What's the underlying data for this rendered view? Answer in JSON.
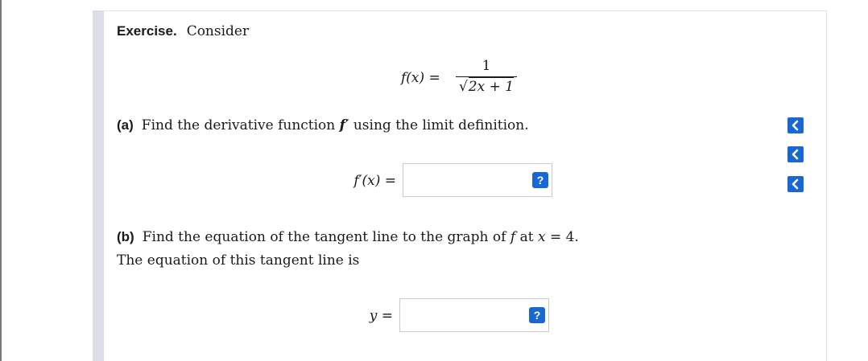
{
  "exercise": {
    "label": "Exercise.",
    "intro": "Consider"
  },
  "formula": {
    "lhs": "f(x) =",
    "numerator": "1",
    "radicand": "2x + 1",
    "sqrt_symbol": "√"
  },
  "part_a": {
    "label": "(a)",
    "text_before": "Find the derivative function",
    "symbol": "f′",
    "text_after": "using the limit definition."
  },
  "answer_a": {
    "label": "f′(x) =",
    "value": "",
    "help_label": "?"
  },
  "part_b": {
    "label": "(b)",
    "text_before": "Find the equation of the tangent line to the graph of",
    "symbol_f": "f",
    "text_at": "at",
    "symbol_x": "x",
    "equals": "= 4."
  },
  "part_b_followup": {
    "text": "The equation of this tangent line is"
  },
  "answer_b": {
    "label": "y =",
    "value": "",
    "help_label": "?"
  },
  "side_nav": {
    "icon": "chevron-left-icon",
    "count": 3
  },
  "colors": {
    "accent": "#1967d2",
    "stripe": "#dcdde6"
  }
}
